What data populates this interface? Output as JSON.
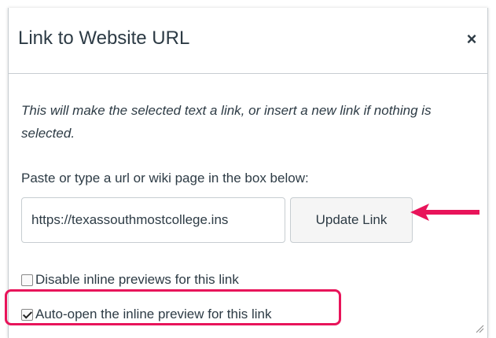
{
  "dialog": {
    "title": "Link to Website URL",
    "close_glyph": "×",
    "description": "This will make the selected text a link, or insert a new link if nothing is selected.",
    "instruction": "Paste or type a url or wiki page in the box below:",
    "url_value": "https://texassouthmostcollege.ins",
    "update_label": "Update Link",
    "disable_previews_label": "Disable inline previews for this link",
    "disable_previews_checked": false,
    "auto_open_label": "Auto-open the inline preview for this link",
    "auto_open_checked": true
  },
  "colors": {
    "annotation": "#e8145a",
    "text": "#2d3b45",
    "border": "#c7cdd1"
  },
  "icons": {
    "close": "close-icon",
    "arrow": "arrow-left-icon",
    "check": "checkmark-icon",
    "resize": "resize-handle-icon"
  }
}
